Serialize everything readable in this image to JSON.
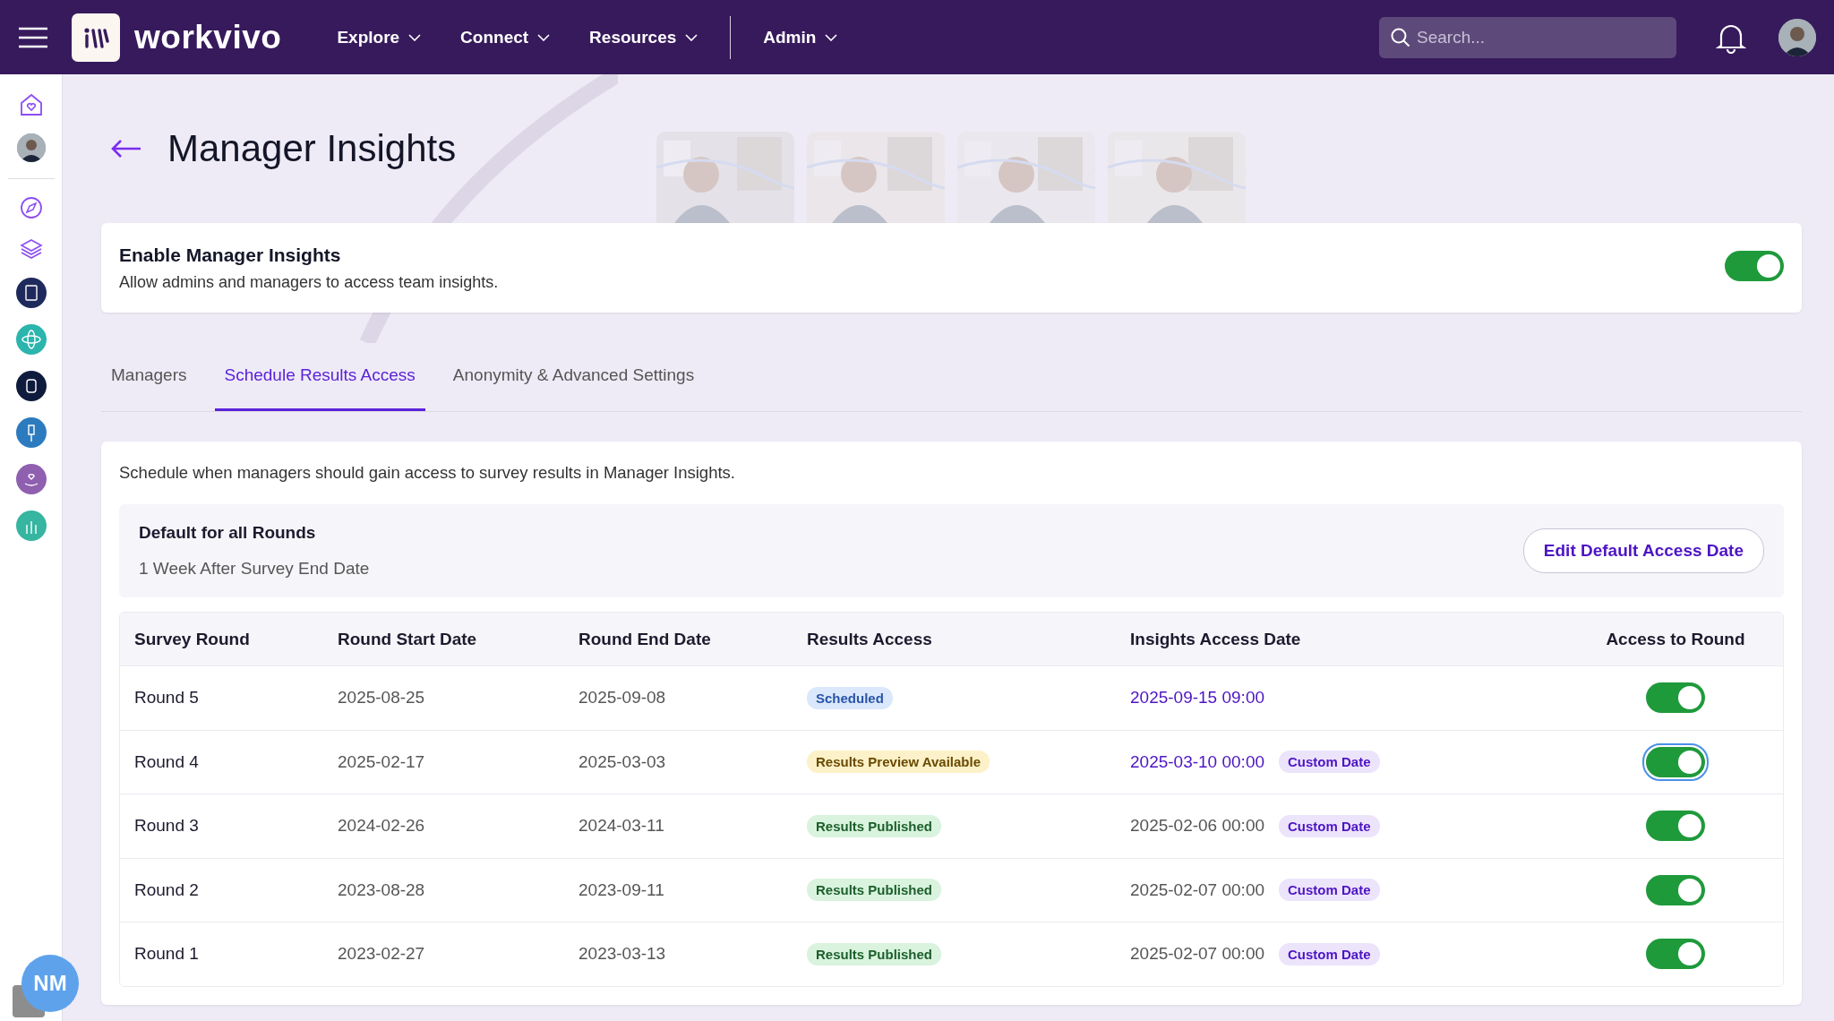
{
  "topbar": {
    "brand": "workvivo",
    "nav": [
      {
        "label": "Explore",
        "kind": "menu"
      },
      {
        "label": "Connect",
        "kind": "menu"
      },
      {
        "label": "Resources",
        "kind": "menu"
      },
      {
        "label": "Admin",
        "kind": "menu"
      }
    ],
    "search": {
      "placeholder": "Search..."
    }
  },
  "sidebar": {
    "apps": [
      {
        "color": "#1f2a5c"
      },
      {
        "color": "#2bb5ad"
      },
      {
        "color": "#0f1b3d"
      },
      {
        "color": "#2d7bbf"
      },
      {
        "color": "#8f5fb0"
      },
      {
        "color": "#36b5a0"
      }
    ],
    "user_initials": "NM"
  },
  "page": {
    "title": "Manager Insights"
  },
  "enable": {
    "title": "Enable Manager Insights",
    "description": "Allow admins and managers to access team insights.",
    "on": true
  },
  "tabs": [
    {
      "label": "Managers",
      "selected": false
    },
    {
      "label": "Schedule Results Access",
      "selected": true
    },
    {
      "label": "Anonymity & Advanced Settings",
      "selected": false
    }
  ],
  "schedule": {
    "intro": "Schedule when managers should gain access to survey results in Manager Insights.",
    "default": {
      "title": "Default for all Rounds",
      "value": "1 Week After Survey End Date",
      "button": "Edit Default Access Date"
    },
    "table": {
      "columns": [
        "Survey Round",
        "Round Start Date",
        "Round End Date",
        "Results Access",
        "Insights Access Date",
        "Access to Round"
      ],
      "rows": [
        {
          "round": "Round 5",
          "start": "2025-08-25",
          "end": "2025-09-08",
          "status": "Scheduled",
          "kind": "scheduled",
          "access_date": "2025-09-15 09:00",
          "linked": true,
          "on": true,
          "focused": false
        },
        {
          "round": "Round 4",
          "start": "2025-02-17",
          "end": "2025-03-03",
          "status": "Results Preview Available",
          "kind": "preview",
          "access_date": "2025-03-10 00:00",
          "linked": true,
          "tag": "Custom Date",
          "on": true,
          "focused": true
        },
        {
          "round": "Round 3",
          "start": "2024-02-26",
          "end": "2024-03-11",
          "status": "Results Published",
          "kind": "published",
          "access_date": "2025-02-06 00:00",
          "linked": false,
          "tag": "Custom Date",
          "on": true,
          "focused": false
        },
        {
          "round": "Round 2",
          "start": "2023-08-28",
          "end": "2023-09-11",
          "status": "Results Published",
          "kind": "published",
          "access_date": "2025-02-07 00:00",
          "linked": false,
          "tag": "Custom Date",
          "on": true,
          "focused": false
        },
        {
          "round": "Round 1",
          "start": "2023-02-27",
          "end": "2023-03-13",
          "status": "Results Published",
          "kind": "published",
          "access_date": "2025-02-07 00:00",
          "linked": false,
          "tag": "Custom Date",
          "on": true,
          "focused": false
        }
      ]
    }
  }
}
